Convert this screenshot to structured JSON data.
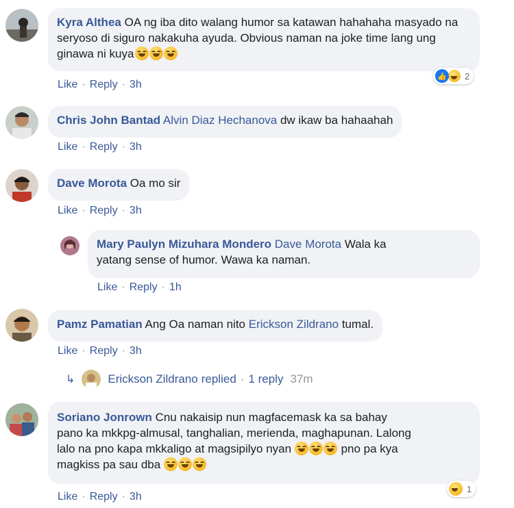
{
  "comments": [
    {
      "author": "Kyra Althea",
      "text": "OA ng iba dito walang humor sa katawan hahahaha masyado na seryoso di siguro nakakuha ayuda. Obvious naman na joke time lang ung ginawa ni kuya",
      "actions": {
        "like": "Like",
        "reply": "Reply",
        "time": "3h"
      },
      "reaction_count": "2"
    },
    {
      "author": "Chris John Bantad",
      "mention": "Alvin Diaz Hechanova",
      "text": "dw ikaw ba hahaahah",
      "actions": {
        "like": "Like",
        "reply": "Reply",
        "time": "3h"
      }
    },
    {
      "author": "Dave Morota",
      "text": "Oa mo sir",
      "actions": {
        "like": "Like",
        "reply": "Reply",
        "time": "3h"
      }
    },
    {
      "author": "Mary Paulyn Mizuhara Mondero",
      "mention": "Dave Morota",
      "text_line1": "Wala ka",
      "text_line2": "yatang sense of humor. Wawa ka naman.",
      "actions": {
        "like": "Like",
        "reply": "Reply",
        "time": "1h"
      }
    },
    {
      "author": "Pamz Pamatian",
      "text_before": "Ang Oa naman nito",
      "mention": "Erickson Zildrano",
      "text_after": "tumal.",
      "actions": {
        "like": "Like",
        "reply": "Reply",
        "time": "3h"
      },
      "replies_link": {
        "name": "Erickson Zildrano",
        "replied": "replied",
        "count": "1 reply",
        "time": "37m"
      }
    },
    {
      "author": "Soriano Jonrown",
      "line1": "Cnu nakaisip nun magfacemask ka sa bahay",
      "line2": "pano ka mkkpg-almusal, tanghalian, merienda, maghapunan. Lalong",
      "line3_a": "lalo na pno kapa mkkaligo at magsipilyo nyan",
      "line3_b": "pno pa kya",
      "line4": "magkiss pa sau dba",
      "actions": {
        "like": "Like",
        "reply": "Reply",
        "time": "3h"
      },
      "reaction_count": "1"
    }
  ],
  "separator": "·",
  "icons": {
    "reply_arrow": "reply-arrow-icon",
    "laughing_emoji": "laughing-emoji-icon",
    "like_badge": "like-reaction-icon",
    "haha_badge": "haha-reaction-icon"
  },
  "colors": {
    "link": "#385898",
    "bubble": "#f0f2f5",
    "muted": "#90949c",
    "like_blue": "#1877f2"
  }
}
